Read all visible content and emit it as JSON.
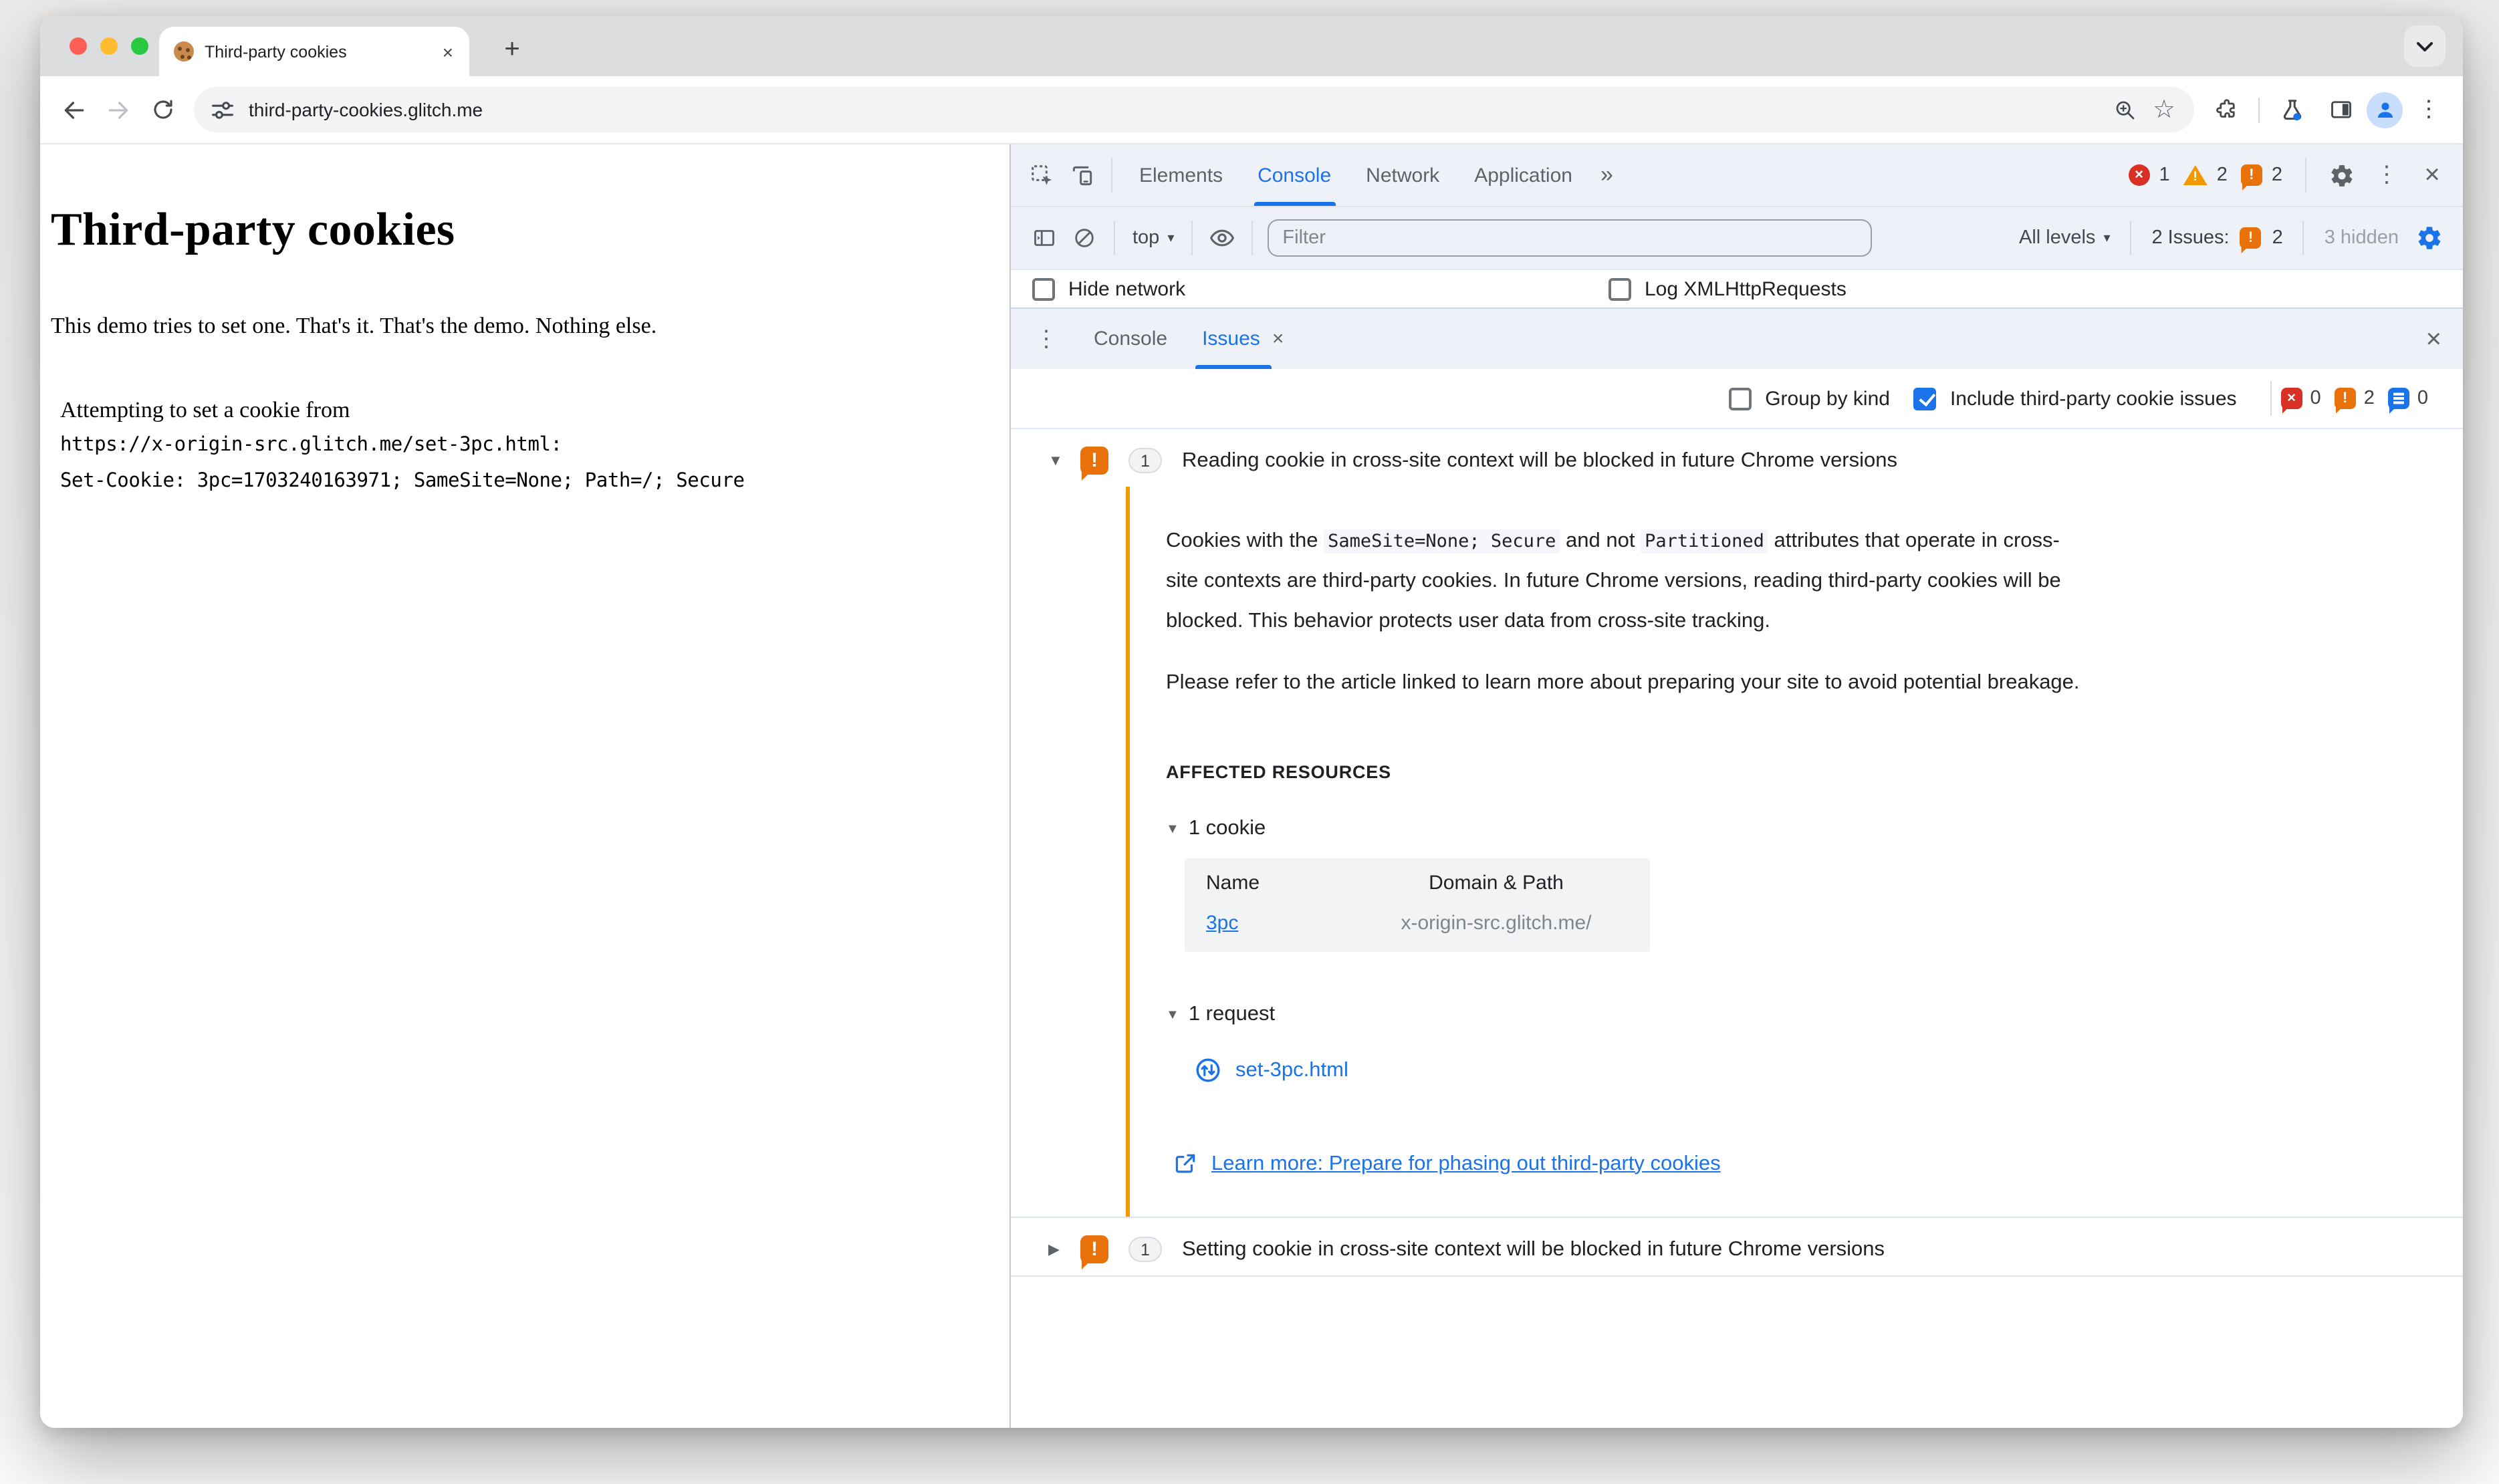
{
  "colors": {
    "accent": "#1a73e8",
    "issue_orange": "#e8710a",
    "bar_orange": "#f29900",
    "error_red": "#d93025",
    "warn_orange": "#f29900"
  },
  "glyphs": {
    "plus": "+",
    "chevrons": "»",
    "kebab": "⋮",
    "close": "×",
    "caret": "▾",
    "tri_down": "▼",
    "tri_right": "▶",
    "star": "☆",
    "bang": "!"
  },
  "browser": {
    "tab_title": "Third-party cookies",
    "url": "third-party-cookies.glitch.me"
  },
  "page": {
    "heading": "Third-party cookies",
    "intro": "This demo tries to set one. That's it. That's the demo. Nothing else.",
    "attempt_label": "Attempting to set a cookie from",
    "attempt_url": "https://x-origin-src.glitch.me/set-3pc.html:",
    "attempt_cookie": "Set-Cookie: 3pc=1703240163971; SameSite=None; Path=/; Secure"
  },
  "devtools": {
    "top_tabs": [
      "Elements",
      "Console",
      "Network",
      "Application"
    ],
    "badges": {
      "errors": "1",
      "warnings": "2",
      "issues": "2"
    },
    "console_toolbar": {
      "context": "top",
      "filter_placeholder": "Filter",
      "levels": "All levels",
      "issues_summary": "2 Issues:",
      "issues_count": "2",
      "hidden": "3 hidden"
    },
    "console_settings": {
      "hide_network": "Hide network",
      "log_xhr": "Log XMLHttpRequests"
    },
    "drawer_tabs": [
      "Console",
      "Issues"
    ],
    "issues_toolbar": {
      "group": "Group by kind",
      "include": "Include third-party cookie issues",
      "error_count": "0",
      "warn_count": "2",
      "info_count": "0"
    },
    "issue1": {
      "count": "1",
      "title": "Reading cookie in cross-site context will be blocked in future Chrome versions",
      "p1a": "Cookies with the ",
      "code1": "SameSite=None; Secure",
      "p1b": " and not ",
      "code2": "Partitioned",
      "p1c": " attributes that operate in cross-site contexts are third-party cookies. In future Chrome versions, reading third-party cookies will be blocked. This behavior protects user data from cross-site tracking.",
      "p2": "Please refer to the article linked to learn more about preparing your site to avoid potential breakage.",
      "affected_heading": "AFFECTED RESOURCES",
      "cookie_section": "1 cookie",
      "table": {
        "headers": [
          "Name",
          "Domain & Path"
        ],
        "row": {
          "name": "3pc",
          "domain": "x-origin-src.glitch.me/"
        }
      },
      "request_section": "1 request",
      "request_name": "set-3pc.html",
      "learn_more": "Learn more: Prepare for phasing out third-party cookies"
    },
    "issue2": {
      "count": "1",
      "title": "Setting cookie in cross-site context will be blocked in future Chrome versions"
    }
  }
}
